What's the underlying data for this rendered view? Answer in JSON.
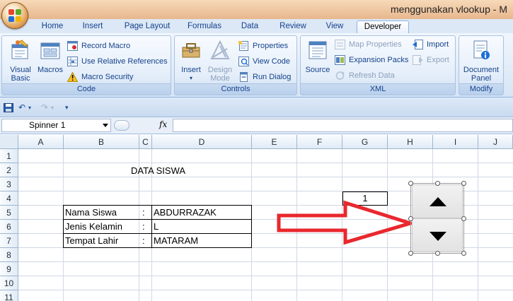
{
  "window": {
    "title": "menggunakan vlookup - M"
  },
  "tabs": [
    "Home",
    "Insert",
    "Page Layout",
    "Formulas",
    "Data",
    "Review",
    "View",
    "Developer"
  ],
  "active_tab": "Developer",
  "ribbon": {
    "code": {
      "caption": "Code",
      "visual_basic": "Visual\nBasic",
      "macros": "Macros",
      "record_macro": "Record Macro",
      "use_relative": "Use Relative References",
      "macro_security": "Macro Security"
    },
    "controls": {
      "caption": "Controls",
      "insert": "Insert",
      "design_mode": "Design\nMode",
      "properties": "Properties",
      "view_code": "View Code",
      "run_dialog": "Run Dialog"
    },
    "xml": {
      "caption": "XML",
      "source": "Source",
      "map_properties": "Map Properties",
      "expansion_packs": "Expansion Packs",
      "refresh_data": "Refresh Data",
      "import": "Import",
      "export": "Export"
    },
    "modify": {
      "caption": "Modify",
      "document_panel": "Document\nPanel"
    }
  },
  "formula_bar": {
    "name_box": "Spinner 1",
    "fx": "fx",
    "formula": ""
  },
  "columns": [
    "A",
    "B",
    "C",
    "D",
    "E",
    "F",
    "G",
    "H",
    "I",
    "J"
  ],
  "rows": [
    "1",
    "2",
    "3",
    "4",
    "5",
    "6",
    "7",
    "8",
    "9",
    "10",
    "11"
  ],
  "cells": {
    "title": "DATA SISWA",
    "g4": "1",
    "labels": [
      "Nama Siswa",
      "Jenis Kelamin",
      "Tempat Lahir"
    ],
    "colons": [
      ":",
      ":",
      ":"
    ],
    "values": [
      "ABDURRAZAK",
      "L",
      "MATARAM"
    ]
  },
  "colors": {
    "arrow": "#e8282e",
    "tab_text": "#15428b"
  },
  "icons": {
    "spinner_up": "triangle-up",
    "spinner_down": "triangle-down"
  }
}
